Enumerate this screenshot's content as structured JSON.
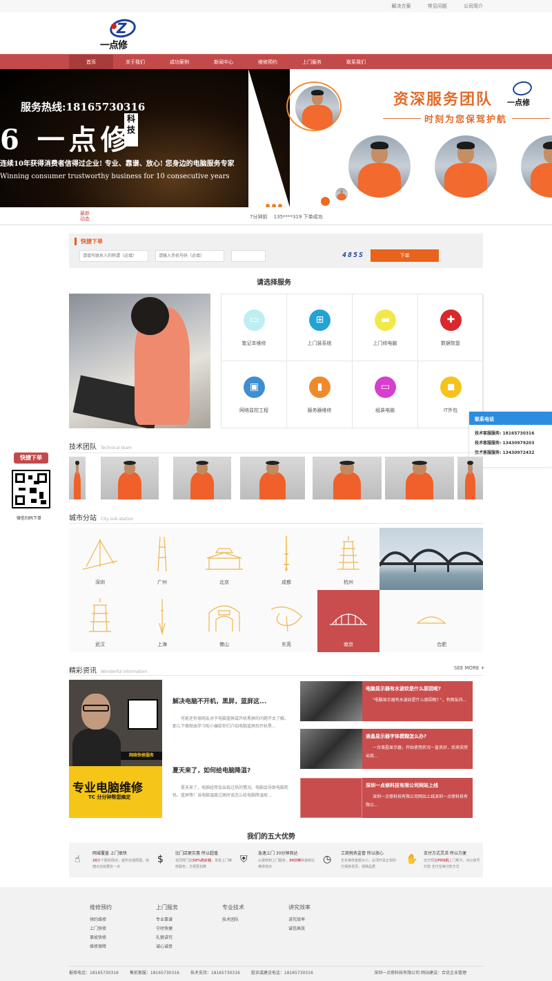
{
  "top_links": [
    "解决方案",
    "常见问题",
    "公司简介"
  ],
  "logo_text": "一点修",
  "nav": [
    "首页",
    "关于我们",
    "成功案例",
    "新闻中心",
    "维修预约",
    "上门服务",
    "联系我们"
  ],
  "banner": {
    "hotline": "服务热线:18165730316",
    "brand": "一点修",
    "brand_tag": "科技",
    "slogan_cn": "连续10年获得消费者信得过企业! 专业、靠谱、放心! 您身边的电脑服务专家",
    "slogan_en": "Winning consumer trustworthy business for 10 consecutive years",
    "team_title": "资深服务团队",
    "team_sub": "时刻为您保驾护航",
    "logo_text": "一点修"
  },
  "newsbar": {
    "label": "最新动态",
    "message": "7分钟前　 135****319 下单成功"
  },
  "quick_order": {
    "title": "快捷下单",
    "name_placeholder": "请填写联系人的称谓（必填）",
    "phone_placeholder": "请输入手机号码（必填）",
    "captcha": "485S",
    "submit": "下单"
  },
  "services": {
    "title": "请选择服务",
    "items": [
      {
        "label": "笔记本维修",
        "icon": "laptop-icon",
        "color": "#bfeef2",
        "glyph": "▭"
      },
      {
        "label": "上门装系统",
        "icon": "windows-icon",
        "color": "#22a3d6",
        "glyph": "⊞"
      },
      {
        "label": "上门修电脑",
        "icon": "computer-icon",
        "color": "#f2e84a",
        "glyph": "▬"
      },
      {
        "label": "数据恢复",
        "icon": "medical-icon",
        "color": "#d8282e",
        "glyph": "✚"
      },
      {
        "label": "网络监控工程",
        "icon": "monitor-icon",
        "color": "#3f8ed0",
        "glyph": "▣"
      },
      {
        "label": "服务器维修",
        "icon": "server-icon",
        "color": "#ef8a2a",
        "glyph": "▮"
      },
      {
        "label": "组装电脑",
        "icon": "desktop-icon",
        "color": "#d63fcf",
        "glyph": "▭"
      },
      {
        "label": "IT外包",
        "icon": "cup-icon",
        "color": "#f6c21c",
        "glyph": "◼"
      }
    ]
  },
  "contact": {
    "title": "联系电话",
    "rows": [
      "技术客服服务: 18165730316",
      "技术客服服务: 13430979203",
      "技术客服服务: 13430972432"
    ]
  },
  "side": {
    "badge": "快捷下单",
    "caption": "微信扫码下单"
  },
  "team": {
    "title": "技术团队",
    "subtitle": "Technical team"
  },
  "city": {
    "title": "城市分站",
    "subtitle": "City sub-station",
    "items": [
      "深圳",
      "广州",
      "北京",
      "成都",
      "杭州",
      "武汉",
      "上海",
      "佛山",
      "东莞",
      "南京",
      "合肥"
    ]
  },
  "news": {
    "title": "精彩资讯",
    "subtitle": "Wonderful information",
    "more": "SEE MORE +",
    "ad": {
      "tag": "网络快修服务",
      "big": "专业电脑维修",
      "small": "TC 分分钟帮您搞定"
    },
    "articles": [
      {
        "title": "解决电脑不开机，黑屏，蓝屏这...",
        "desc": "可能还有很网友对于电脑蓝屏或开机黑屏的问题不太了解。那么下面就由学习啦小编给你们介绍电脑蓝屏后开机黑..."
      },
      {
        "title": "夏天来了，如何给电脑降温?",
        "desc": "夏天来了，电脑经常会出现过热的情况。电脑会导致电脑死机、蓝屏等！当电脑温度过高时该怎么给电脑降温呢..."
      }
    ],
    "right": [
      {
        "title": "电脑显示器有水波纹是什么原因呢?",
        "desc": "\"电脑显示器有水波纹是什么原因呢? \"，有网友问..."
      },
      {
        "title": "液晶显示器字体模糊怎么办?",
        "desc": "一台液晶显示器，开始使用状况一直良好，后来突然出现..."
      },
      {
        "title": "深圳一点修科技有限公司网站上线",
        "desc": "深圳一点修科技有限公司网站上线深圳一点修科技有限公..."
      }
    ]
  },
  "advantages": {
    "title": "我们的五大优势",
    "items": [
      {
        "icon": "hand-icon",
        "glyph": "☝",
        "title": "网城覆盖 上门很快",
        "pre": "",
        "em": "20",
        "desc": "多个服务网点，遍布全城周围，快捷点击就要份一点"
      },
      {
        "icon": "money-icon",
        "glyph": "$",
        "title": "比门店更实惠 所以超值",
        "pre": "花同样门店",
        "em": "50%的价钱",
        "desc": "，享受上门维修服务，方便更划算"
      },
      {
        "icon": "shield-icon",
        "glyph": "⛨",
        "title": "急速上门 30分钟到达",
        "pre": "从报修到上门服务，",
        "em": "30分钟",
        "desc": "快速到达维修地点"
      },
      {
        "icon": "clock-icon",
        "glyph": "◷",
        "title": "工商税务监管 所以放心",
        "pre": "",
        "em": "",
        "desc": "无论维修金额大小，必须开具正规的打保修发票，保障品质"
      },
      {
        "icon": "pay-icon",
        "glyph": "✋",
        "title": "支付方式灵活 所以方便",
        "pre": "支付现金",
        "em": "POS机",
        "desc": "上门刷卡，对公账号打款 支付宝等付款方式"
      }
    ]
  },
  "footer": {
    "cols": [
      {
        "title": "维修预约",
        "items": [
          "预约维修",
          "上门快修",
          "事故快修",
          "维修保障"
        ]
      },
      {
        "title": "上门服务",
        "items": [
          "专业靠谱",
          "守时快捷",
          "礼貌讲究",
          "诚心诚意"
        ]
      },
      {
        "title": "专业技术",
        "items": [
          "技术团队"
        ]
      },
      {
        "title": "讲究效率",
        "items": [
          "讲究效率",
          "诚信高效"
        ]
      }
    ],
    "bottom": [
      "报修电话：18165730316",
      "售前客服：18165730316",
      "技术支持：18165730316",
      "投诉或建议电话：18165730316"
    ],
    "copyright": "深圳一点修科技有限公司 网站建设：合优企业管理"
  },
  "colors": {
    "nav": "#c34a4a",
    "accent": "#e8631c",
    "city_active": "#c94d4d"
  }
}
